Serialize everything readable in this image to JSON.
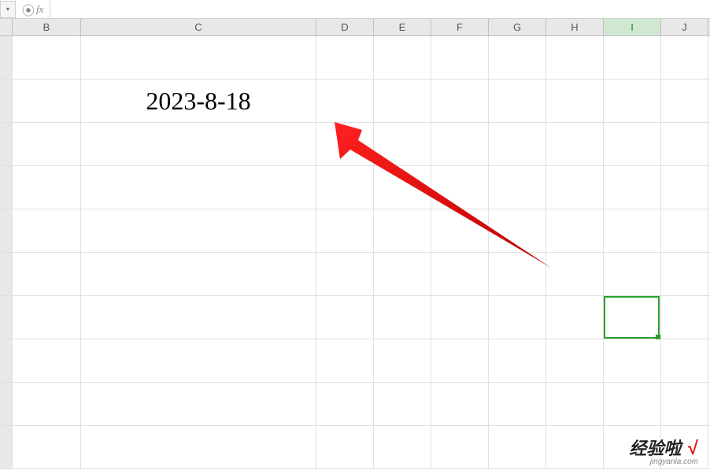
{
  "formula_bar": {
    "fx_label": "fx",
    "input_value": ""
  },
  "columns": [
    "B",
    "C",
    "D",
    "E",
    "F",
    "G",
    "H",
    "I",
    "J"
  ],
  "active_column": "I",
  "cell_data": {
    "date_value": "2023-8-18"
  },
  "selected_cell": {
    "row": 7,
    "col": "I"
  },
  "watermark": {
    "main": "经验啦",
    "check": "√",
    "sub": "jingyanla.com"
  }
}
